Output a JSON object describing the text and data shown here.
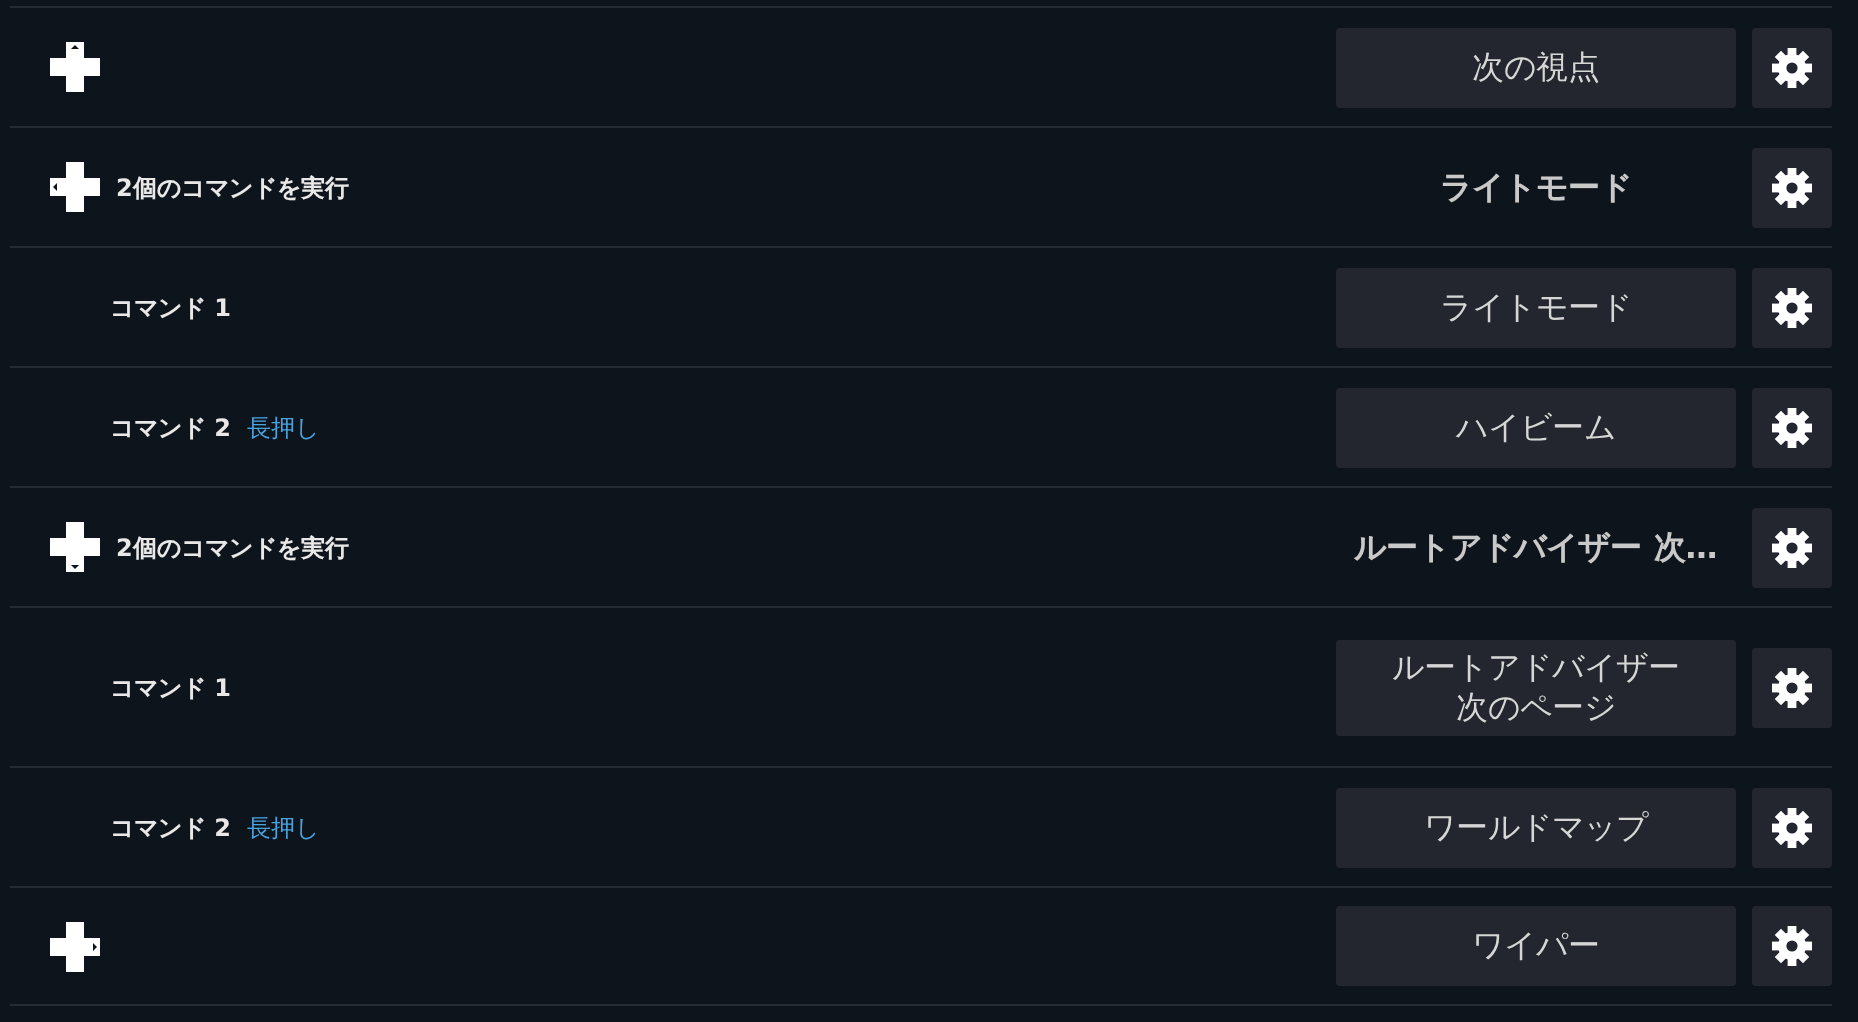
{
  "rows": [
    {
      "kind": "binding",
      "dpad": {
        "up": true,
        "down": false,
        "left": false,
        "right": false
      },
      "action": "次の視点"
    },
    {
      "kind": "group",
      "dpad": {
        "up": false,
        "down": false,
        "left": true,
        "right": false
      },
      "label": "2個のコマンドを実行",
      "summary": "ライトモード"
    },
    {
      "kind": "command",
      "label": "コマンド 1",
      "action": "ライトモード"
    },
    {
      "kind": "command",
      "label": "コマンド 2",
      "tag": "長押し",
      "action": "ハイビーム"
    },
    {
      "kind": "group",
      "dpad": {
        "up": false,
        "down": true,
        "left": false,
        "right": false
      },
      "label": "2個のコマンドを実行",
      "summary": "ルートアドバイザー 次…"
    },
    {
      "kind": "command",
      "label": "コマンド 1",
      "action": [
        "ルートアドバイザー",
        "次のページ"
      ]
    },
    {
      "kind": "command",
      "label": "コマンド 2",
      "tag": "長押し",
      "action": "ワールドマップ"
    },
    {
      "kind": "binding",
      "dpad": {
        "up": false,
        "down": false,
        "left": false,
        "right": true
      },
      "action": "ワイパー"
    }
  ]
}
